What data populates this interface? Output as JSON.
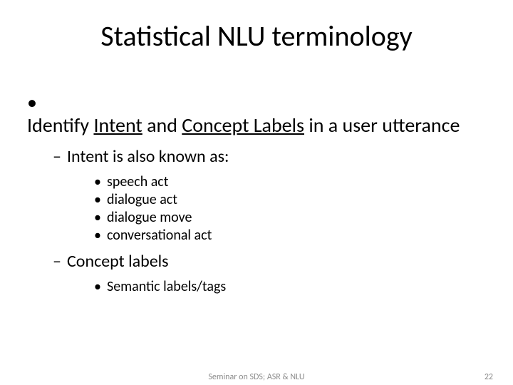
{
  "title": "Statistical NLU terminology",
  "bullet1_pre": "Identify ",
  "bullet1_u1": "Intent",
  "bullet1_mid": " and ",
  "bullet1_u2": "Concept Labels",
  "bullet1_post": " in a user utterance",
  "sub1": "Intent is also known as:",
  "sub1_items": {
    "a": "speech act",
    "b": "dialogue act",
    "c": "dialogue move",
    "d": "conversational act"
  },
  "sub2": "Concept labels",
  "sub2_items": {
    "a": "Semantic labels/tags"
  },
  "footer_center": "Seminar on SDS; ASR & NLU",
  "footer_right": "22"
}
